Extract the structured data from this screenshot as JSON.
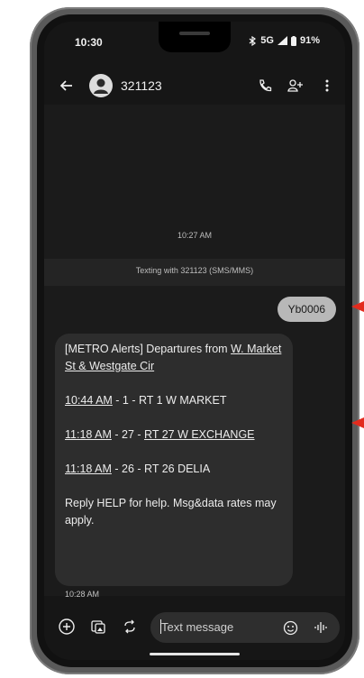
{
  "status_bar": {
    "time": "10:30",
    "network": "5G",
    "battery": "91%"
  },
  "header": {
    "contact": "321123"
  },
  "thread": {
    "date_stamp": "10:27 AM",
    "texting_with": "Texting with 321123 (SMS/MMS)",
    "sent_message": "Yb0006",
    "received": {
      "line1_prefix": "[METRO Alerts] Departures from ",
      "line1_link": "W. Market St & Westgate Cir",
      "dep1_time": "10:44 AM",
      "dep1_rest": " - 1 - RT 1 W MARKET",
      "dep2_time": "11:18 AM",
      "dep2_mid": " - 27 - ",
      "dep2_route": "RT 27 W EXCHANGE",
      "dep3_time": "11:18 AM",
      "dep3_rest": " - 26 - RT 26 DELIA",
      "footer": "Reply HELP for help. Msg&data rates may apply."
    },
    "received_time": "10:28 AM"
  },
  "composer": {
    "placeholder": "Text message"
  },
  "icons": {
    "back": "arrow-left-icon",
    "avatar": "person-avatar-icon",
    "call": "phone-icon",
    "add_contact": "add-person-icon",
    "more": "more-vert-icon",
    "add": "plus-circle-icon",
    "gallery": "gallery-icon",
    "quick_reply": "sync-reply-icon",
    "emoji": "smiley-icon",
    "voice": "voice-wave-icon"
  },
  "colors": {
    "annotation_arrow": "#e32b1e",
    "sent_bubble": "#b8b8b8",
    "received_bubble": "#2d2d2d"
  }
}
